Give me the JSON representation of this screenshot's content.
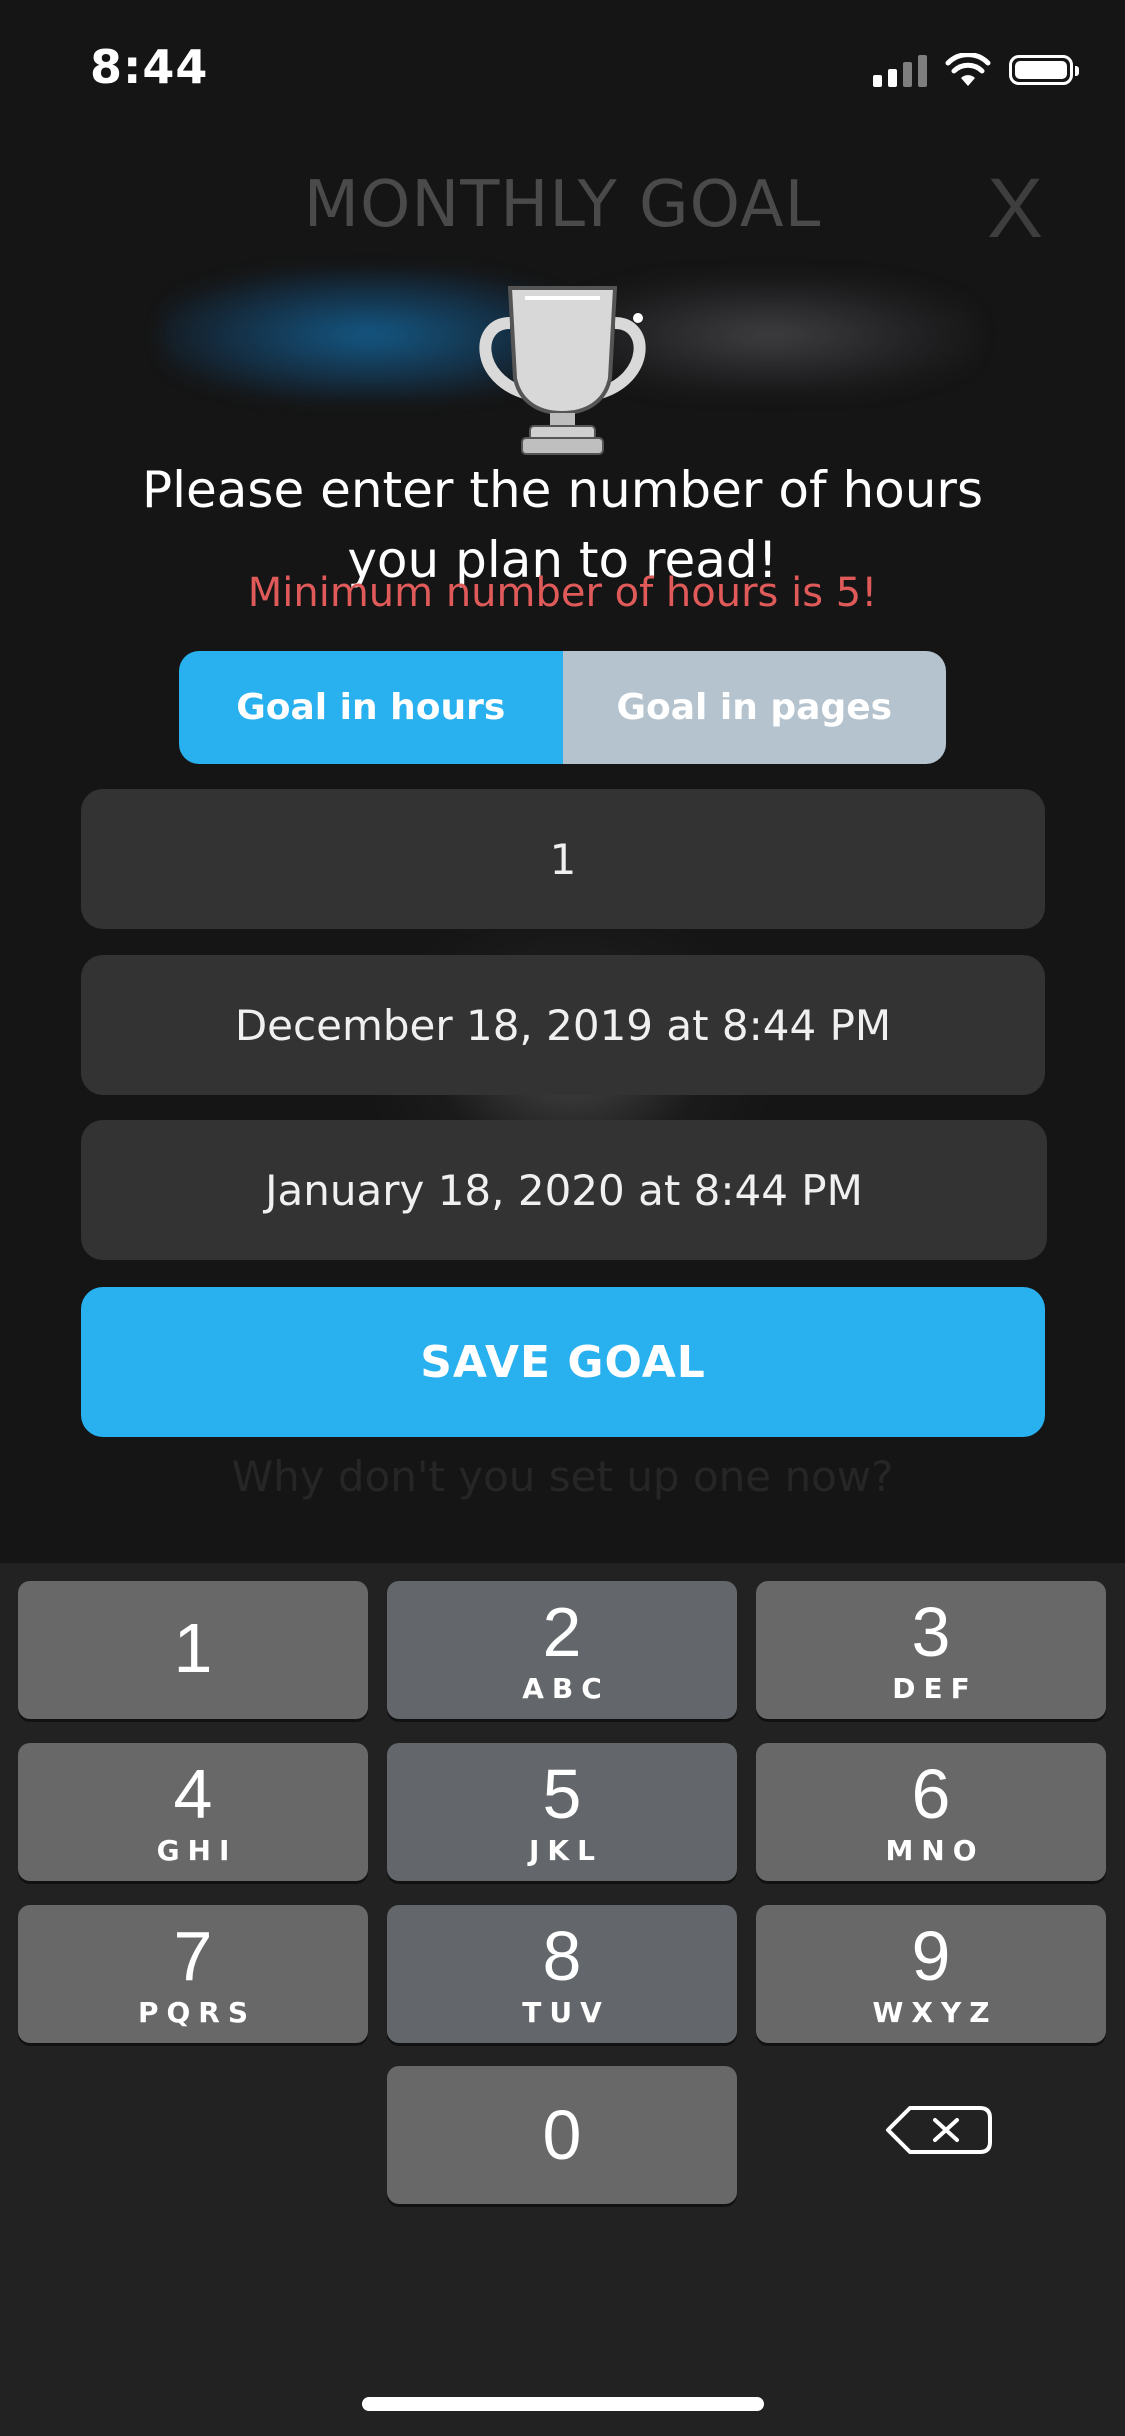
{
  "status_bar": {
    "time": "8:44"
  },
  "header": {
    "title": "MONTHLY GOAL",
    "close_label": "X"
  },
  "prompt": "Please enter the number of hours you plan to read!",
  "error": "Minimum number of hours is 5!",
  "segmented": {
    "hours_label": "Goal in hours",
    "pages_label": "Goal in pages",
    "selected": "Goal in hours"
  },
  "fields": {
    "amount_value": "1",
    "start_date": "December 18, 2019 at 8:44 PM",
    "end_date": "January 18, 2020 at 8:44 PM"
  },
  "save_button": "SAVE GOAL",
  "background_hint": "Why don't you set up one now?",
  "keypad": [
    {
      "num": "1",
      "letters": ""
    },
    {
      "num": "2",
      "letters": "ABC"
    },
    {
      "num": "3",
      "letters": "DEF"
    },
    {
      "num": "4",
      "letters": "GHI"
    },
    {
      "num": "5",
      "letters": "JKL"
    },
    {
      "num": "6",
      "letters": "MNO"
    },
    {
      "num": "7",
      "letters": "PQRS"
    },
    {
      "num": "8",
      "letters": "TUV"
    },
    {
      "num": "9",
      "letters": "WXYZ"
    },
    {
      "num": "0",
      "letters": ""
    }
  ],
  "colors": {
    "accent": "#29b0ee",
    "error": "#e05a5a",
    "segment_inactive": "#b5c3ce"
  }
}
